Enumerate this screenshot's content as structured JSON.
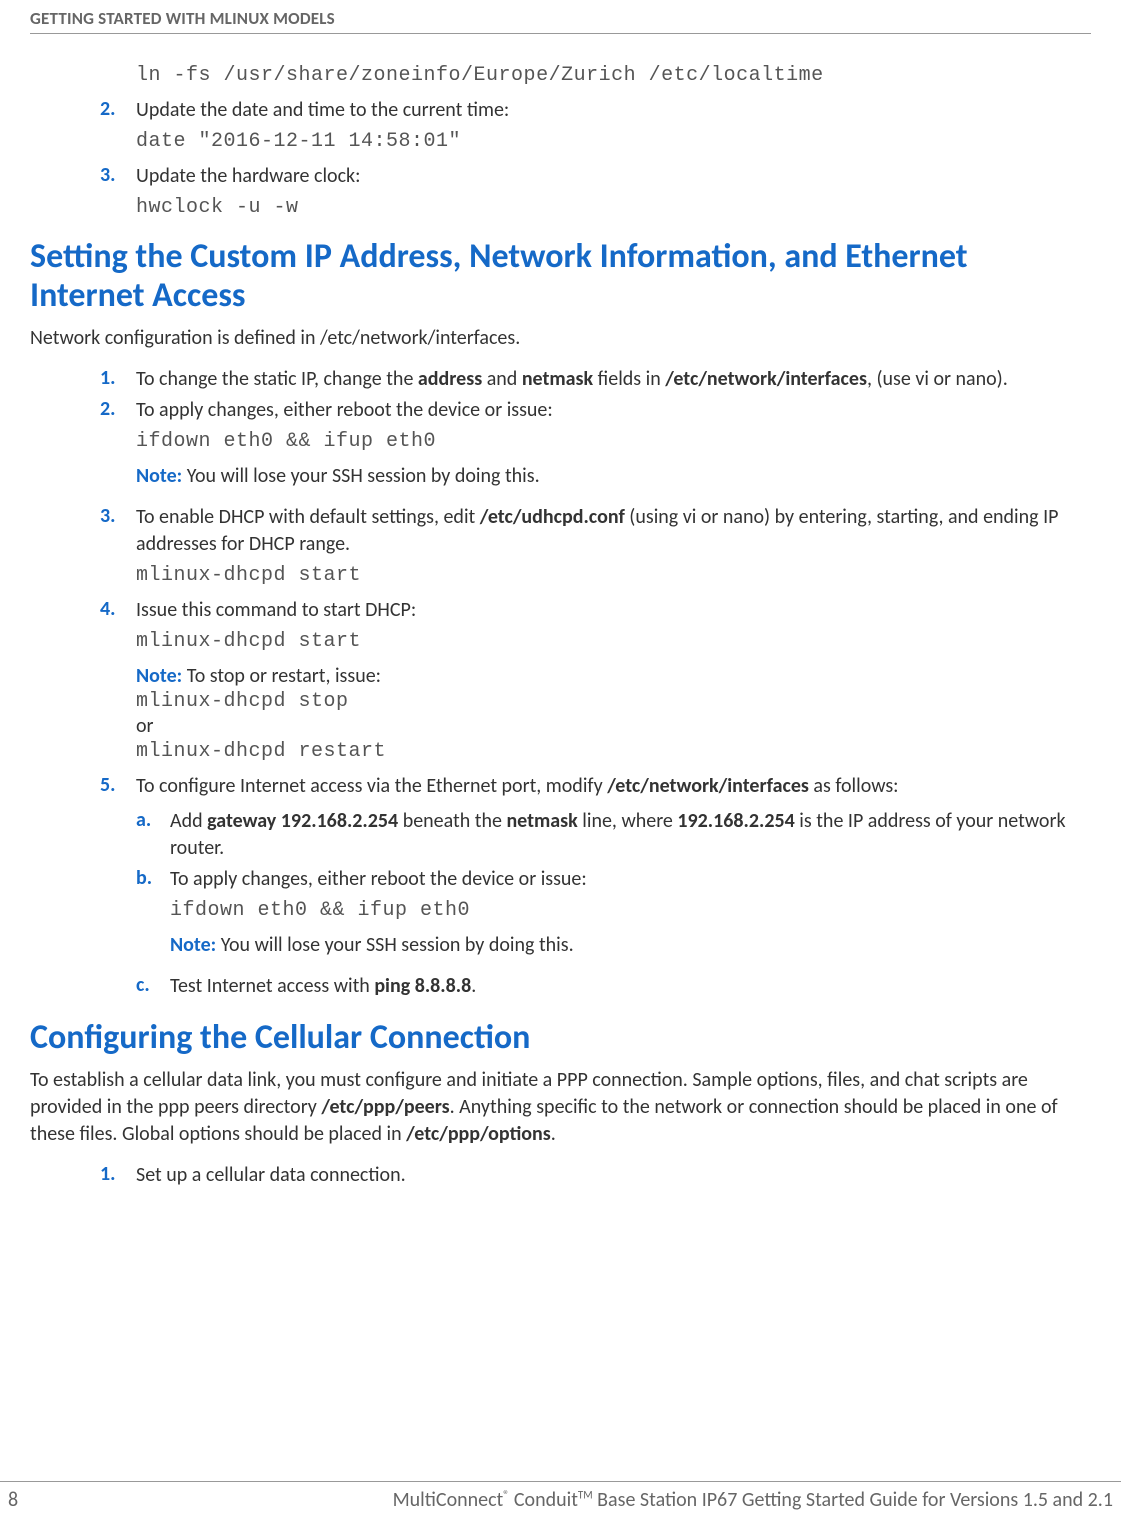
{
  "header": {
    "title": "GETTING STARTED WITH MLINUX MODELS"
  },
  "intro": {
    "code1": "ln -fs /usr/share/zoneinfo/Europe/Zurich /etc/localtime",
    "step2": {
      "num": "2.",
      "text": "Update the date and time to the current time:"
    },
    "code2": "date \"2016-12-11 14:58:01\"",
    "step3": {
      "num": "3.",
      "text": "Update the hardware clock:"
    },
    "code3": "hwclock -u -w"
  },
  "section1": {
    "title": "Setting the Custom IP Address, Network Information, and Ethernet Internet Access",
    "intro": "Network configuration is defined in /etc/network/interfaces.",
    "step1": {
      "num": "1.",
      "pre": "To change the static IP, change the ",
      "b1": "address",
      "mid1": " and ",
      "b2": "netmask",
      "mid2": " fields in ",
      "b3": "/etc/network/interfaces",
      "post": ", (use vi or nano)."
    },
    "step2": {
      "num": "2.",
      "text": "To apply changes, either reboot the device or issue:"
    },
    "code2": "ifdown eth0 && ifup eth0",
    "note2": {
      "label": "Note: ",
      "text": "You will lose your SSH session by doing this."
    },
    "step3": {
      "num": "3.",
      "pre": "To enable DHCP with default settings, edit ",
      "b1": "/etc/udhcpd.conf",
      "post": " (using vi or nano) by entering, starting, and ending IP addresses for DHCP range."
    },
    "code3": "mlinux-dhcpd start",
    "step4": {
      "num": "4.",
      "text": "Issue this command to start DHCP:"
    },
    "code4": "mlinux-dhcpd start",
    "note4": {
      "label": "Note: ",
      "text": "To stop or restart, issue:"
    },
    "code4b": "mlinux-dhcpd stop",
    "or": "or",
    "code4c": "mlinux-dhcpd restart",
    "step5": {
      "num": "5.",
      "pre": "To configure Internet access via the Ethernet port, modify ",
      "b1": "/etc/network/interfaces",
      "post": " as follows:"
    },
    "sub_a": {
      "num": "a.",
      "pre": "Add ",
      "b1": "gateway 192.168.2.254",
      "mid1": " beneath the ",
      "b2": "netmask",
      "mid2": " line, where ",
      "b3": "192.168.2.254",
      "post": " is the IP address of your network router."
    },
    "sub_b": {
      "num": "b.",
      "text": "To apply changes, either reboot the device or issue:"
    },
    "code_b": "ifdown eth0 && ifup eth0",
    "note_b": {
      "label": "Note: ",
      "text": "You will lose your SSH session by doing this."
    },
    "sub_c": {
      "num": "c.",
      "pre": "Test Internet access with ",
      "b1": "ping 8.8.8.8",
      "post": "."
    }
  },
  "section2": {
    "title": "Configuring the Cellular Connection",
    "intro_pre": "To establish a cellular data link, you must configure and initiate a PPP connection. Sample options, files, and chat scripts are provided in the ppp peers directory ",
    "intro_b1": "/etc/ppp/peers",
    "intro_mid": ". Anything specific to the network or connection should be placed in one of these files. Global options should be placed in ",
    "intro_b2": "/etc/ppp/options",
    "intro_post": ".",
    "step1": {
      "num": "1.",
      "text": "Set up a cellular data connection."
    }
  },
  "footer": {
    "page": "8",
    "title_pre": "MultiConnect",
    "reg": "®",
    "title_mid": " Conduit",
    "tm": "TM",
    "title_post": " Base Station IP67 Getting Started Guide for Versions 1.5 and 2.1"
  }
}
